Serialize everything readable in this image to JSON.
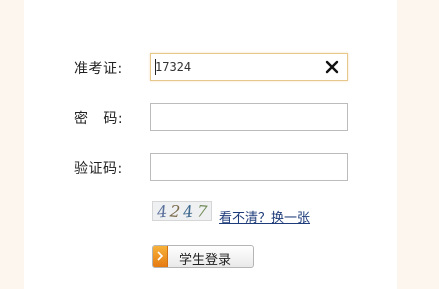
{
  "form": {
    "ticket_label": "准考证:",
    "ticket_value": "17324",
    "password_label": "密   码:",
    "password_value": "",
    "captcha_label": "验证码:",
    "captcha_value": ""
  },
  "captcha": {
    "digits": [
      "4",
      "2",
      "4",
      "7"
    ],
    "digit_colors": [
      "#5a6f9a",
      "#7b6a4a",
      "#3f6a8f",
      "#6f8a55"
    ],
    "refresh_link": "看不清？换一张"
  },
  "login_button": {
    "label": "学生登录",
    "accent_color": "#f08a1c"
  },
  "icons": {
    "clear": "close-icon",
    "login": "arrow-right-icon"
  }
}
